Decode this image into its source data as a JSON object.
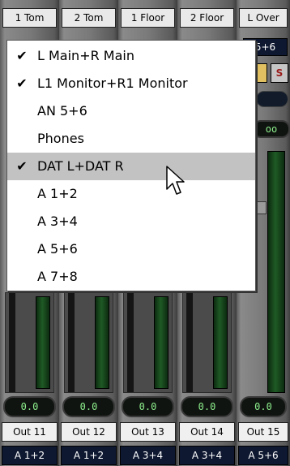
{
  "channels": [
    {
      "name": "1 Tom",
      "out": "Out 11",
      "out_routing": "A 1+2",
      "gain": "0.0"
    },
    {
      "name": "2 Tom",
      "out": "Out 12",
      "out_routing": "A 1+2",
      "gain": "0.0"
    },
    {
      "name": "1 Floor",
      "out": "Out 13",
      "out_routing": "A 3+4",
      "gain": "0.0"
    },
    {
      "name": "2 Floor",
      "out": "Out 14",
      "out_routing": "A 3+4",
      "gain": "0.0"
    },
    {
      "name": "L Over",
      "out": "Out 15",
      "out_routing": "A 5+6",
      "gain": "0.0"
    }
  ],
  "right_channel": {
    "routing": "5+6",
    "solo_label": "S",
    "pan_value": "oo"
  },
  "routing_menu": {
    "items": [
      {
        "label": "L Main+R Main",
        "checked": true,
        "check_glyph": "✔"
      },
      {
        "label": "L1 Monitor+R1 Monitor",
        "checked": true,
        "check_glyph": "✔"
      },
      {
        "label": "AN 5+6",
        "checked": false,
        "check_glyph": ""
      },
      {
        "label": "Phones",
        "checked": false,
        "check_glyph": ""
      },
      {
        "label": "DAT L+DAT R",
        "checked": true,
        "check_glyph": "✔",
        "highlighted": true
      },
      {
        "label": "A 1+2",
        "checked": false,
        "check_glyph": ""
      },
      {
        "label": "A 3+4",
        "checked": false,
        "check_glyph": ""
      },
      {
        "label": "A 5+6",
        "checked": false,
        "check_glyph": ""
      },
      {
        "label": "A 7+8",
        "checked": false,
        "check_glyph": ""
      }
    ]
  },
  "icons": {
    "cursor": "arrow-cursor-icon",
    "check": "checkmark-icon"
  }
}
